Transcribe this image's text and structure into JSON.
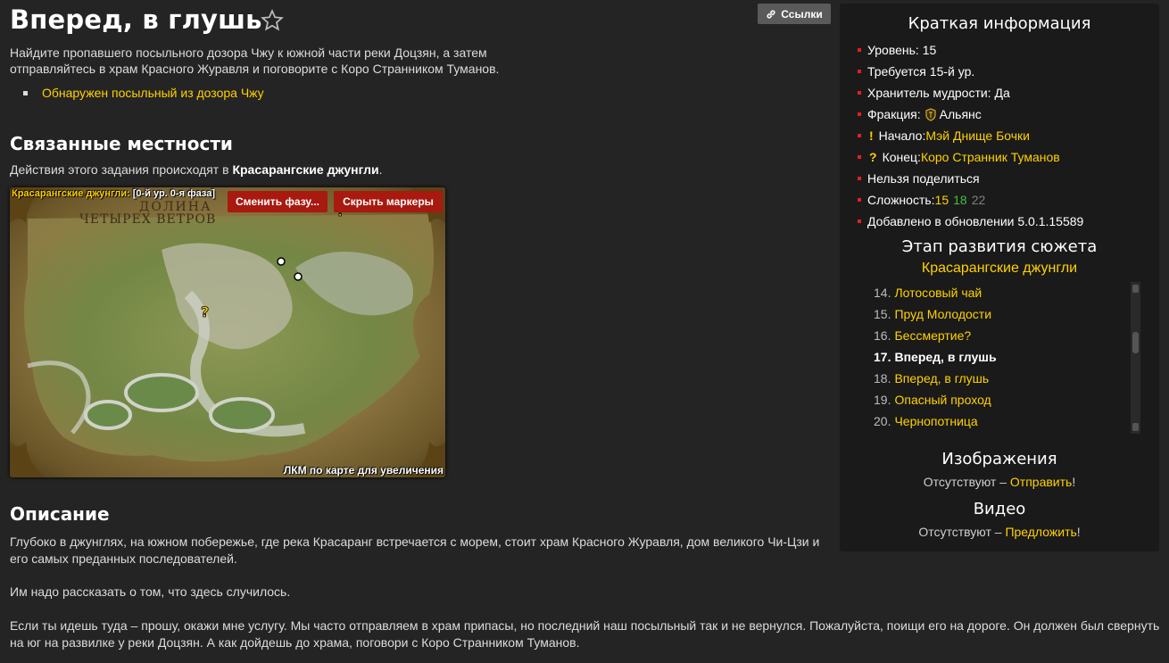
{
  "page": {
    "title": "Вперед, в глушь",
    "links_label": "Ссылки",
    "intro": "Найдите пропавшего посыльного дозора Чжу к южной части реки Доцзян, а затем отправляйтесь в храм Красного Журавля и поговорите с Коро Странником Туманов.",
    "objective": "Обнаружен посыльный из дозора Чжу"
  },
  "related": {
    "heading": "Связанные местности",
    "text_prefix": "Действия этого задания происходят в ",
    "zone": "Красарангские джунгли",
    "text_suffix": "."
  },
  "map": {
    "zone_label": "Красарангские джунгли:",
    "phase_label": " [0-й ур. 0-я фаза]",
    "change_phase": "Сменить фазу...",
    "hide_markers": "Скрыть маркеры",
    "region_line1": "ДОЛИНА",
    "region_line2": "ЧЕТЫРЕХ ВЕТРОВ",
    "hint": "ЛКМ по карте для увеличения"
  },
  "description": {
    "heading": "Описание",
    "p1": "Глубоко в джунглях, на южном побережье, где река Красаранг встречается с морем, стоит храм Красного Журавля, дом великого Чи-Цзи и его самых преданных последователей.",
    "p2": "Им надо рассказать о том, что здесь случилось.",
    "p3": "Если ты идешь туда – прошу, окажи мне услугу. Мы часто отправляем в храм припасы, но последний наш посыльный так и не вернулся. Пожалуйста, поищи его на дороге. Он должен был свернуть на юг на развилке у реки Доцзян. А как дойдешь до храма, поговори с Коро Странником Туманов."
  },
  "sidebar": {
    "title": "Краткая информация",
    "level": "Уровень: 15",
    "required": "Требуется 15-й ур.",
    "lorekeeper": "Хранитель мудрости: Да",
    "faction_label": "Фракция: ",
    "faction_value": "Альянс",
    "start_label": "Начало: ",
    "start_value": "Мэй Днище Бочки",
    "end_label": "Конец: ",
    "end_value": "Коро Странник Туманов",
    "shareable": "Нельзя поделиться",
    "difficulty_label": "Сложность: ",
    "difficulty": [
      "15",
      "18",
      "22"
    ],
    "added": "Добавлено в обновлении 5.0.1.15589",
    "storyline_title": "Этап развития сюжета",
    "storyline_zone": "Красарангские джунгли",
    "storyline": [
      {
        "num": "14.",
        "name": "Лотосовый чай"
      },
      {
        "num": "15.",
        "name": "Пруд Молодости"
      },
      {
        "num": "16.",
        "name": "Бессмертие?"
      },
      {
        "num": "17.",
        "name": "Вперед, в глушь"
      },
      {
        "num": "18.",
        "name": "Вперед, в глушь"
      },
      {
        "num": "19.",
        "name": "Опасный проход"
      },
      {
        "num": "20.",
        "name": "Чернопотница"
      }
    ],
    "images_title": "Изображения",
    "images_text": "Отсутствуют – ",
    "images_link": "Отправить",
    "video_title": "Видео",
    "video_text": "Отсутствуют – ",
    "video_link": "Предложить",
    "excl": "!"
  },
  "colors": {
    "link": "#ffd100",
    "difficulty_orange": "#ffd100",
    "difficulty_green": "#40bf40",
    "difficulty_gray": "#808080",
    "map_button": "#a8190f"
  }
}
